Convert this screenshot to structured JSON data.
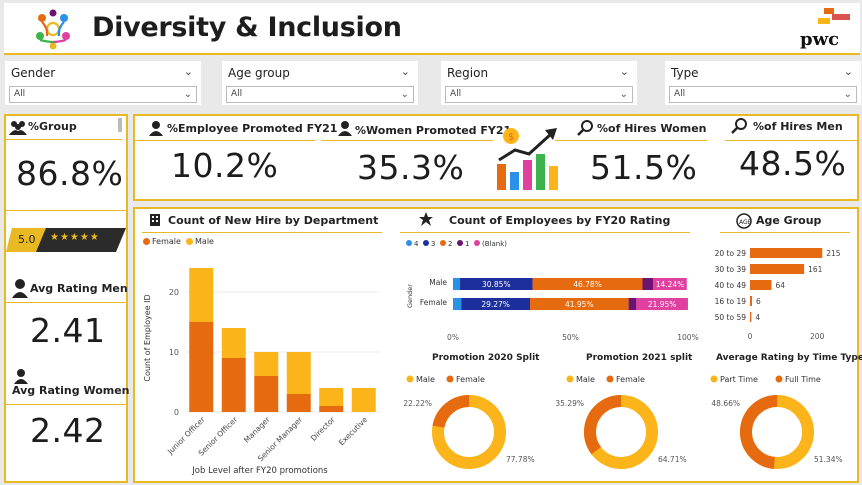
{
  "header": {
    "title": "Diversity & Inclusion",
    "brand": "pwc"
  },
  "filters": [
    {
      "label": "Gender",
      "value": "All"
    },
    {
      "label": "Age group",
      "value": "All"
    },
    {
      "label": "Region",
      "value": "All"
    },
    {
      "label": "Type",
      "value": "All"
    }
  ],
  "left": {
    "group_label": "%Group",
    "group_value": "86.8%",
    "rating_badge": "5.0",
    "stars": "★★★★★",
    "avg_men_label": "Avg Rating Men",
    "avg_men_value": "2.41",
    "avg_women_label": "Avg Rating Women",
    "avg_women_value": "2.42"
  },
  "kpis": {
    "promoted_label": "%Employee Promoted FY21",
    "promoted_value": "10.2%",
    "women_promoted_label": "%Women Promoted FY21",
    "women_promoted_value": "35.3%",
    "hires_women_label": "%of Hires Women",
    "hires_women_value": "51.5%",
    "hires_men_label": "%of Hires Men",
    "hires_men_value": "48.5%"
  },
  "colors": {
    "female": "#e66b10",
    "male": "#fbb41a",
    "accent": "#e8b923"
  },
  "chart_data": [
    {
      "type": "bar",
      "title": "Count of New Hire by Department",
      "xlabel": "Job Level after FY20 promotions",
      "ylabel": "Count of Employee ID",
      "categories": [
        "Junior Officer",
        "Senior Officer",
        "Manager",
        "Senior Manager",
        "Director",
        "Executive"
      ],
      "series": [
        {
          "name": "Female",
          "values": [
            15,
            9,
            6,
            3,
            1,
            0
          ]
        },
        {
          "name": "Male",
          "values": [
            9,
            5,
            4,
            7,
            3,
            4
          ]
        }
      ],
      "yticks": [
        "0",
        "10",
        "20"
      ],
      "ylim": [
        0,
        25
      ],
      "stacked": true,
      "legend": "top-left"
    },
    {
      "type": "bar",
      "title": "Count of Employees by FY20 Rating",
      "orientation": "horizontal",
      "stacked_percent": true,
      "ylabel": "Gender",
      "categories": [
        "Male",
        "Female"
      ],
      "legend_items": [
        "4",
        "3",
        "2",
        "1",
        "(Blank)"
      ],
      "legend_colors": [
        "#2b90e8",
        "#1c2f9c",
        "#e66b10",
        "#6c1470",
        "#e040a0"
      ],
      "series": [
        {
          "name": "4",
          "values": [
            3.0,
            3.5
          ]
        },
        {
          "name": "3",
          "values": [
            30.85,
            29.27
          ]
        },
        {
          "name": "2",
          "values": [
            46.78,
            41.95
          ]
        },
        {
          "name": "1",
          "values": [
            4.6,
            3.3
          ]
        },
        {
          "name": "(Blank)",
          "values": [
            14.24,
            21.95
          ]
        }
      ],
      "data_labels": [
        [
          "30.85%",
          "46.78%",
          "14.24%"
        ],
        [
          "29.27%",
          "41.95%",
          "21.95%"
        ]
      ],
      "xticks": [
        "0%",
        "50%",
        "100%"
      ]
    },
    {
      "type": "bar",
      "title": "Age Group",
      "orientation": "horizontal",
      "categories": [
        "20 to 29",
        "30 to 39",
        "40 to 49",
        "16 to 19",
        "50 to 59"
      ],
      "values": [
        215,
        161,
        64,
        6,
        4
      ],
      "xticks": [
        "0",
        "200"
      ],
      "xlim": [
        0,
        240
      ]
    },
    {
      "type": "pie",
      "title": "Promotion 2020 Split",
      "labels": [
        "Male",
        "Female"
      ],
      "values": [
        77.78,
        22.22
      ],
      "value_labels": [
        "77.78%",
        "22.22%"
      ]
    },
    {
      "type": "pie",
      "title": "Promotion 2021 split",
      "labels": [
        "Male",
        "Female"
      ],
      "values": [
        64.71,
        35.29
      ],
      "value_labels": [
        "64.71%",
        "35.29%"
      ]
    },
    {
      "type": "pie",
      "title": "Average Rating by Time Type",
      "labels": [
        "Part Time",
        "Full Time"
      ],
      "values": [
        51.34,
        48.66
      ],
      "value_labels": [
        "51.34%",
        "48.66%"
      ]
    }
  ]
}
